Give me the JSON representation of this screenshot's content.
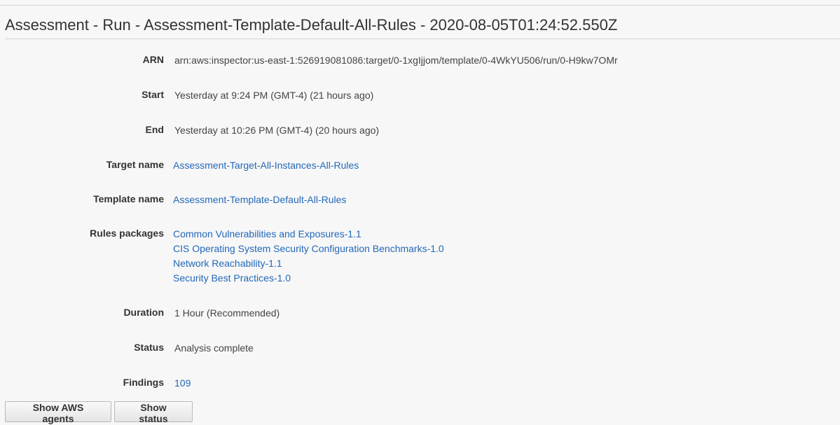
{
  "page": {
    "title": "Assessment - Run - Assessment-Template-Default-All-Rules - 2020-08-05T01:24:52.550Z"
  },
  "details": {
    "arn": {
      "label": "ARN",
      "value": "arn:aws:inspector:us-east-1:526919081086:target/0-1xgIjjom/template/0-4WkYU506/run/0-H9kw7OMr"
    },
    "start": {
      "label": "Start",
      "value": "Yesterday at 9:24 PM (GMT-4) (21 hours ago)"
    },
    "end": {
      "label": "End",
      "value": "Yesterday at 10:26 PM (GMT-4) (20 hours ago)"
    },
    "target_name": {
      "label": "Target name",
      "value": "Assessment-Target-All-Instances-All-Rules"
    },
    "template_name": {
      "label": "Template name",
      "value": "Assessment-Template-Default-All-Rules"
    },
    "rules_packages": {
      "label": "Rules packages",
      "items": [
        "Common Vulnerabilities and Exposures-1.1",
        "CIS Operating System Security Configuration Benchmarks-1.0",
        "Network Reachability-1.1",
        "Security Best Practices-1.0"
      ]
    },
    "duration": {
      "label": "Duration",
      "value": "1 Hour (Recommended)"
    },
    "status": {
      "label": "Status",
      "value": "Analysis complete"
    },
    "findings": {
      "label": "Findings",
      "value": "109"
    }
  },
  "actions": {
    "show_agents_label": "Show AWS agents",
    "show_status_label": "Show status"
  },
  "colors": {
    "link": "#2368b8",
    "background": "#f7f7f7",
    "label_text": "#333333",
    "value_text": "#444444"
  }
}
